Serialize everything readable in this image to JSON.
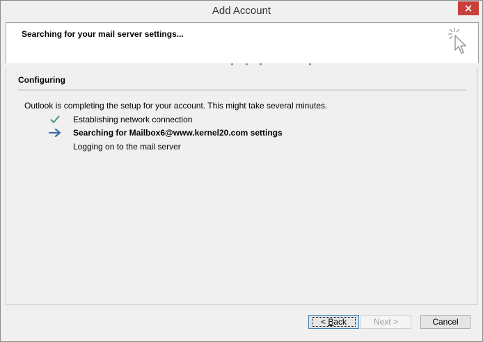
{
  "window": {
    "title": "Add Account"
  },
  "header": {
    "heading": "Searching for your mail server settings..."
  },
  "section": {
    "title": "Configuring",
    "intro": "Outlook is completing the setup for your account. This might take several minutes."
  },
  "steps": [
    {
      "label": "Establishing network connection",
      "status": "done",
      "icon": "check-icon"
    },
    {
      "label": "Searching for Mailbox6@www.kernel20.com settings",
      "status": "in-progress",
      "icon": "arrow-right-icon"
    },
    {
      "label": "Logging on to the mail server",
      "status": "pending",
      "icon": ""
    }
  ],
  "buttons": {
    "back_prefix": "< ",
    "back_accel": "B",
    "back_rest": "ack",
    "next": "Next >",
    "cancel": "Cancel"
  },
  "colors": {
    "close_button": "#c7413a",
    "check": "#5a9a78",
    "arrow": "#3a6ea5",
    "focus_border": "#3c7fb1"
  }
}
